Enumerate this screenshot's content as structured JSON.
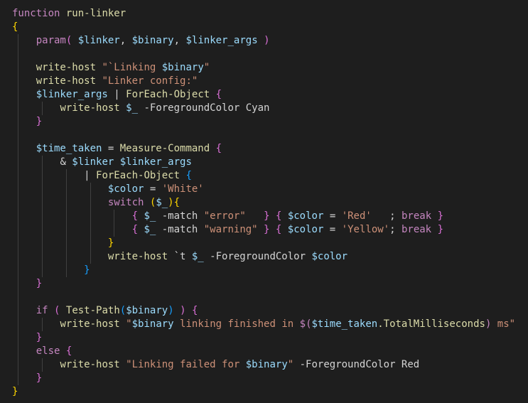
{
  "colors": {
    "background": "#1e1e1e",
    "default": "#d4d4d4",
    "keyword": "#c586c0",
    "function": "#dcdcaa",
    "variable": "#9cdcfe",
    "string": "#ce9178",
    "parameter_flag": "#d4d4d4",
    "brace_gold": "#ffd700",
    "brace_purple": "#da70d6",
    "brace_blue": "#179fff",
    "indent_guide": "#404040"
  },
  "code": {
    "language": "PowerShell",
    "lines": [
      [
        {
          "t": "function",
          "c": "keyword"
        },
        {
          "t": " run-linker",
          "c": "function"
        }
      ],
      [
        {
          "t": "{",
          "c": "brace_gold"
        }
      ],
      [
        {
          "t": "    "
        },
        {
          "t": "param",
          "c": "keyword"
        },
        {
          "t": "( ",
          "c": "brace_purple"
        },
        {
          "t": "$linker",
          "c": "variable"
        },
        {
          "t": ", "
        },
        {
          "t": "$binary",
          "c": "variable"
        },
        {
          "t": ", "
        },
        {
          "t": "$linker_args",
          "c": "variable"
        },
        {
          "t": " )",
          "c": "brace_purple"
        }
      ],
      [],
      [
        {
          "t": "    "
        },
        {
          "t": "write-host",
          "c": "function"
        },
        {
          "t": " "
        },
        {
          "t": "\"`Linking ",
          "c": "string"
        },
        {
          "t": "$binary",
          "c": "variable"
        },
        {
          "t": "\"",
          "c": "string"
        }
      ],
      [
        {
          "t": "    "
        },
        {
          "t": "write-host",
          "c": "function"
        },
        {
          "t": " "
        },
        {
          "t": "\"Linker config:\"",
          "c": "string"
        }
      ],
      [
        {
          "t": "    "
        },
        {
          "t": "$linker_args",
          "c": "variable"
        },
        {
          "t": " | "
        },
        {
          "t": "ForEach-Object",
          "c": "function"
        },
        {
          "t": " "
        },
        {
          "t": "{",
          "c": "brace_purple"
        }
      ],
      [
        {
          "t": "        "
        },
        {
          "t": "write-host",
          "c": "function"
        },
        {
          "t": " "
        },
        {
          "t": "$_",
          "c": "variable"
        },
        {
          "t": " -ForegroundColor",
          "c": "parameter_flag"
        },
        {
          "t": " Cyan"
        }
      ],
      [
        {
          "t": "    "
        },
        {
          "t": "}",
          "c": "brace_purple"
        }
      ],
      [],
      [
        {
          "t": "    "
        },
        {
          "t": "$time_taken",
          "c": "variable"
        },
        {
          "t": " = "
        },
        {
          "t": "Measure-Command",
          "c": "function"
        },
        {
          "t": " "
        },
        {
          "t": "{",
          "c": "brace_purple"
        }
      ],
      [
        {
          "t": "        "
        },
        {
          "t": "& "
        },
        {
          "t": "$linker",
          "c": "variable"
        },
        {
          "t": " "
        },
        {
          "t": "$linker_args",
          "c": "variable"
        }
      ],
      [
        {
          "t": "            | "
        },
        {
          "t": "ForEach-Object",
          "c": "function"
        },
        {
          "t": " "
        },
        {
          "t": "{",
          "c": "brace_blue"
        }
      ],
      [
        {
          "t": "                "
        },
        {
          "t": "$color",
          "c": "variable"
        },
        {
          "t": " = "
        },
        {
          "t": "'White'",
          "c": "string"
        }
      ],
      [
        {
          "t": "                "
        },
        {
          "t": "switch",
          "c": "keyword"
        },
        {
          "t": " "
        },
        {
          "t": "(",
          "c": "brace_gold"
        },
        {
          "t": "$_",
          "c": "variable"
        },
        {
          "t": ")",
          "c": "brace_gold"
        },
        {
          "t": "{",
          "c": "brace_gold"
        }
      ],
      [
        {
          "t": "                    "
        },
        {
          "t": "{",
          "c": "brace_purple"
        },
        {
          "t": " "
        },
        {
          "t": "$_",
          "c": "variable"
        },
        {
          "t": " -match "
        },
        {
          "t": "\"error\"",
          "c": "string"
        },
        {
          "t": "   "
        },
        {
          "t": "}",
          "c": "brace_purple"
        },
        {
          "t": " "
        },
        {
          "t": "{",
          "c": "brace_purple"
        },
        {
          "t": " "
        },
        {
          "t": "$color",
          "c": "variable"
        },
        {
          "t": " = "
        },
        {
          "t": "'Red'",
          "c": "string"
        },
        {
          "t": "   ; "
        },
        {
          "t": "break",
          "c": "keyword"
        },
        {
          "t": " "
        },
        {
          "t": "}",
          "c": "brace_purple"
        }
      ],
      [
        {
          "t": "                    "
        },
        {
          "t": "{",
          "c": "brace_purple"
        },
        {
          "t": " "
        },
        {
          "t": "$_",
          "c": "variable"
        },
        {
          "t": " -match "
        },
        {
          "t": "\"warning\"",
          "c": "string"
        },
        {
          "t": " "
        },
        {
          "t": "}",
          "c": "brace_purple"
        },
        {
          "t": " "
        },
        {
          "t": "{",
          "c": "brace_purple"
        },
        {
          "t": " "
        },
        {
          "t": "$color",
          "c": "variable"
        },
        {
          "t": " = "
        },
        {
          "t": "'Yellow'",
          "c": "string"
        },
        {
          "t": "; "
        },
        {
          "t": "break",
          "c": "keyword"
        },
        {
          "t": " "
        },
        {
          "t": "}",
          "c": "brace_purple"
        }
      ],
      [
        {
          "t": "                "
        },
        {
          "t": "}",
          "c": "brace_gold"
        }
      ],
      [
        {
          "t": "                "
        },
        {
          "t": "write-host",
          "c": "function"
        },
        {
          "t": " `t "
        },
        {
          "t": "$_",
          "c": "variable"
        },
        {
          "t": " -ForegroundColor",
          "c": "parameter_flag"
        },
        {
          "t": " "
        },
        {
          "t": "$color",
          "c": "variable"
        }
      ],
      [
        {
          "t": "            "
        },
        {
          "t": "}",
          "c": "brace_blue"
        }
      ],
      [
        {
          "t": "    "
        },
        {
          "t": "}",
          "c": "brace_purple"
        }
      ],
      [],
      [
        {
          "t": "    "
        },
        {
          "t": "if",
          "c": "keyword"
        },
        {
          "t": " "
        },
        {
          "t": "(",
          "c": "brace_purple"
        },
        {
          "t": " "
        },
        {
          "t": "Test-Path",
          "c": "function"
        },
        {
          "t": "(",
          "c": "brace_blue"
        },
        {
          "t": "$binary",
          "c": "variable"
        },
        {
          "t": ")",
          "c": "brace_blue"
        },
        {
          "t": " "
        },
        {
          "t": ")",
          "c": "brace_purple"
        },
        {
          "t": " "
        },
        {
          "t": "{",
          "c": "brace_purple"
        }
      ],
      [
        {
          "t": "        "
        },
        {
          "t": "write-host",
          "c": "function"
        },
        {
          "t": " "
        },
        {
          "t": "\"",
          "c": "string"
        },
        {
          "t": "$binary",
          "c": "variable"
        },
        {
          "t": " linking finished in ",
          "c": "string"
        },
        {
          "t": "$(",
          "c": "keyword"
        },
        {
          "t": "$time_taken",
          "c": "variable"
        },
        {
          "t": ".TotalMilliseconds",
          "c": "function"
        },
        {
          "t": ")",
          "c": "keyword"
        },
        {
          "t": " ms\"",
          "c": "string"
        }
      ],
      [
        {
          "t": "    "
        },
        {
          "t": "}",
          "c": "brace_purple"
        }
      ],
      [
        {
          "t": "    "
        },
        {
          "t": "else",
          "c": "keyword"
        },
        {
          "t": " "
        },
        {
          "t": "{",
          "c": "brace_purple"
        }
      ],
      [
        {
          "t": "        "
        },
        {
          "t": "write-host",
          "c": "function"
        },
        {
          "t": " "
        },
        {
          "t": "\"Linking failed for ",
          "c": "string"
        },
        {
          "t": "$binary",
          "c": "variable"
        },
        {
          "t": "\"",
          "c": "string"
        },
        {
          "t": " -ForegroundColor",
          "c": "parameter_flag"
        },
        {
          "t": " Red"
        }
      ],
      [
        {
          "t": "    "
        },
        {
          "t": "}",
          "c": "brace_purple"
        }
      ],
      [
        {
          "t": "}",
          "c": "brace_gold"
        }
      ]
    ]
  }
}
